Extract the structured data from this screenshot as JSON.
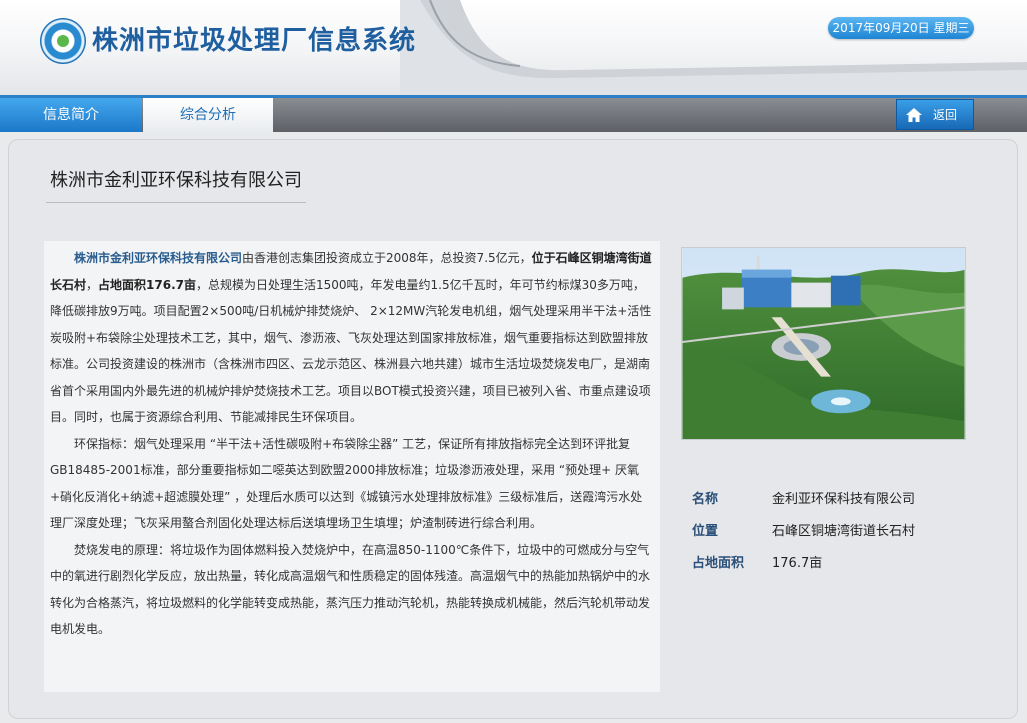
{
  "header": {
    "title": "株洲市垃圾处理厂信息系统",
    "date": "2017年09月20日  星期三",
    "logo_icon": "recycle-logo-icon"
  },
  "nav": {
    "tabs": [
      {
        "label": "信息简介",
        "active": true
      },
      {
        "label": "综合分析",
        "active": false
      }
    ],
    "back_label": "返回",
    "back_icon": "home-icon"
  },
  "colors": {
    "accent": "#1b78c8",
    "label": "#2a4f78",
    "highlight": "#2a5d8f"
  },
  "main": {
    "company_title": "株洲市金利亚环保科技有限公司",
    "article": {
      "p1": {
        "name": "株洲市金利亚环保科技有限公司",
        "t1": "由香港创志集团投资成立于2008年，总投资7.5亿元，",
        "location": "位于石峰区铜塘湾街道长石村",
        "t2": "，",
        "area": "占地面积176.7亩",
        "t3": "，总规模为日处理生活1500吨，年发电量约1.5亿千瓦时，年可节约标煤30多万吨，降低碳排放9万吨。项目配置2×500吨/日机械炉排焚烧炉、 2×12MW汽轮发电机组，烟气处理采用半干法+活性炭吸附+布袋除尘处理技术工艺，其中，烟气、渗沥液、飞灰处理达到国家排放标准，烟气重要指标达到欧盟排放标准。公司投资建设的株洲市（含株洲市四区、云龙示范区、株洲县六地共建）城市生活垃圾焚烧发电厂，是湖南省首个采用国内外最先进的机械炉排炉焚烧技术工艺。项目以BOT模式投资兴建，项目已被列入省、市重点建设项目。同时，也属于资源综合利用、节能减排民生环保项目。"
      },
      "p2": "环保指标：烟气处理采用 “半干法+活性碳吸附+布袋除尘器” 工艺，保证所有排放指标完全达到环评批复GB18485-2001标准，部分重要指标如二噁英达到欧盟2000排放标准；垃圾渗沥液处理，采用 “预处理+ 厌氧+硝化反消化+纳滤+超滤膜处理” ，处理后水质可以达到《城镇污水处理排放标准》三级标准后，送霞湾污水处理厂深度处理；飞灰采用螯合剂固化处理达标后送填埋场卫生填埋；炉渣制砖进行综合利用。",
      "p3": "焚烧发电的原理：将垃圾作为固体燃料投入焚烧炉中，在高温850-1100℃条件下，垃圾中的可燃成分与空气中的氧进行剧烈化学反应，放出热量，转化成高温烟气和性质稳定的固体残渣。高温烟气中的热能加热锅炉中的水转化为合格蒸汽，将垃圾燃料的化学能转变成热能，蒸汽压力推动汽轮机，热能转换成机械能，然后汽轮机带动发电机发电。"
    },
    "info": [
      {
        "label": "名称",
        "value": "金利亚环保科技有限公司"
      },
      {
        "label": "位置",
        "value": "石峰区铜塘湾街道长石村"
      },
      {
        "label": "占地面积",
        "value": "176.7亩"
      }
    ]
  }
}
